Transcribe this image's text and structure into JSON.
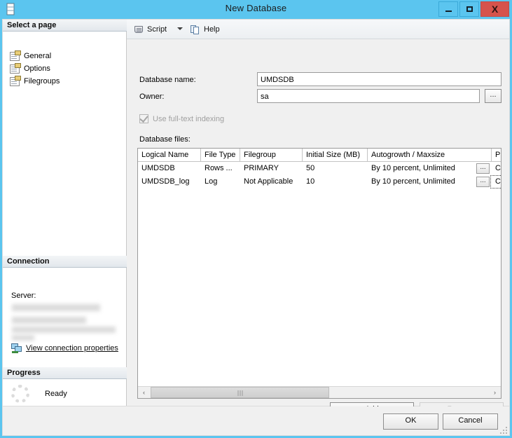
{
  "window": {
    "title": "New Database",
    "icon": "database-icon",
    "controls": {
      "minimize": "minimize-icon",
      "maximize": "maximize-icon",
      "close": "X"
    }
  },
  "sidebar": {
    "select_page_header": "Select a page",
    "pages": [
      {
        "label": "General",
        "icon": "page-icon",
        "selected": true
      },
      {
        "label": "Options",
        "icon": "page-icon",
        "selected": false
      },
      {
        "label": "Filegroups",
        "icon": "page-icon",
        "selected": false
      }
    ],
    "connection": {
      "header": "Connection",
      "server_label": "Server:",
      "server_value": "",
      "link_label": "View connection properties",
      "link_icon": "connection-icon"
    },
    "progress": {
      "header": "Progress",
      "status": "Ready",
      "icon": "spinner-icon"
    }
  },
  "toolbar": {
    "script_label": "Script",
    "script_icon": "script-icon",
    "script_caret": "chevron-down-icon",
    "help_label": "Help",
    "help_icon": "help-icon"
  },
  "form": {
    "database_name_label": "Database name:",
    "database_name_value": "UMDSDB",
    "owner_label": "Owner:",
    "owner_value": "sa",
    "owner_browse_label": "...",
    "fulltext_label": "Use full-text indexing",
    "fulltext_checked": true,
    "fulltext_enabled": false,
    "database_files_label": "Database files:"
  },
  "grid": {
    "columns": [
      "Logical Name",
      "File Type",
      "Filegroup",
      "Initial Size (MB)",
      "Autogrowth / Maxsize",
      "P"
    ],
    "rows": [
      {
        "logical_name": "UMDSDB",
        "file_type": "Rows ...",
        "filegroup": "PRIMARY",
        "initial_size": "50",
        "autogrowth": "By 10 percent, Unlimited",
        "autogrowth_button": "...",
        "path": "C"
      },
      {
        "logical_name": "UMDSDB_log",
        "file_type": "Log",
        "filegroup": "Not Applicable",
        "initial_size": "10",
        "autogrowth": "By 10 percent, Unlimited",
        "autogrowth_button": "...",
        "path": "C"
      }
    ],
    "scrollbar": {
      "left_arrow": "‹",
      "right_arrow": "›"
    },
    "add_label": "Add",
    "remove_label": "Remove",
    "remove_enabled": false
  },
  "footer": {
    "ok_label": "OK",
    "cancel_label": "Cancel"
  },
  "colors": {
    "titlebar": "#5bc5ef",
    "close_button": "#d6534c",
    "panel": "#f0f0f0",
    "grid_background": "#ffffff",
    "disabled_text": "#a0a0a0"
  }
}
